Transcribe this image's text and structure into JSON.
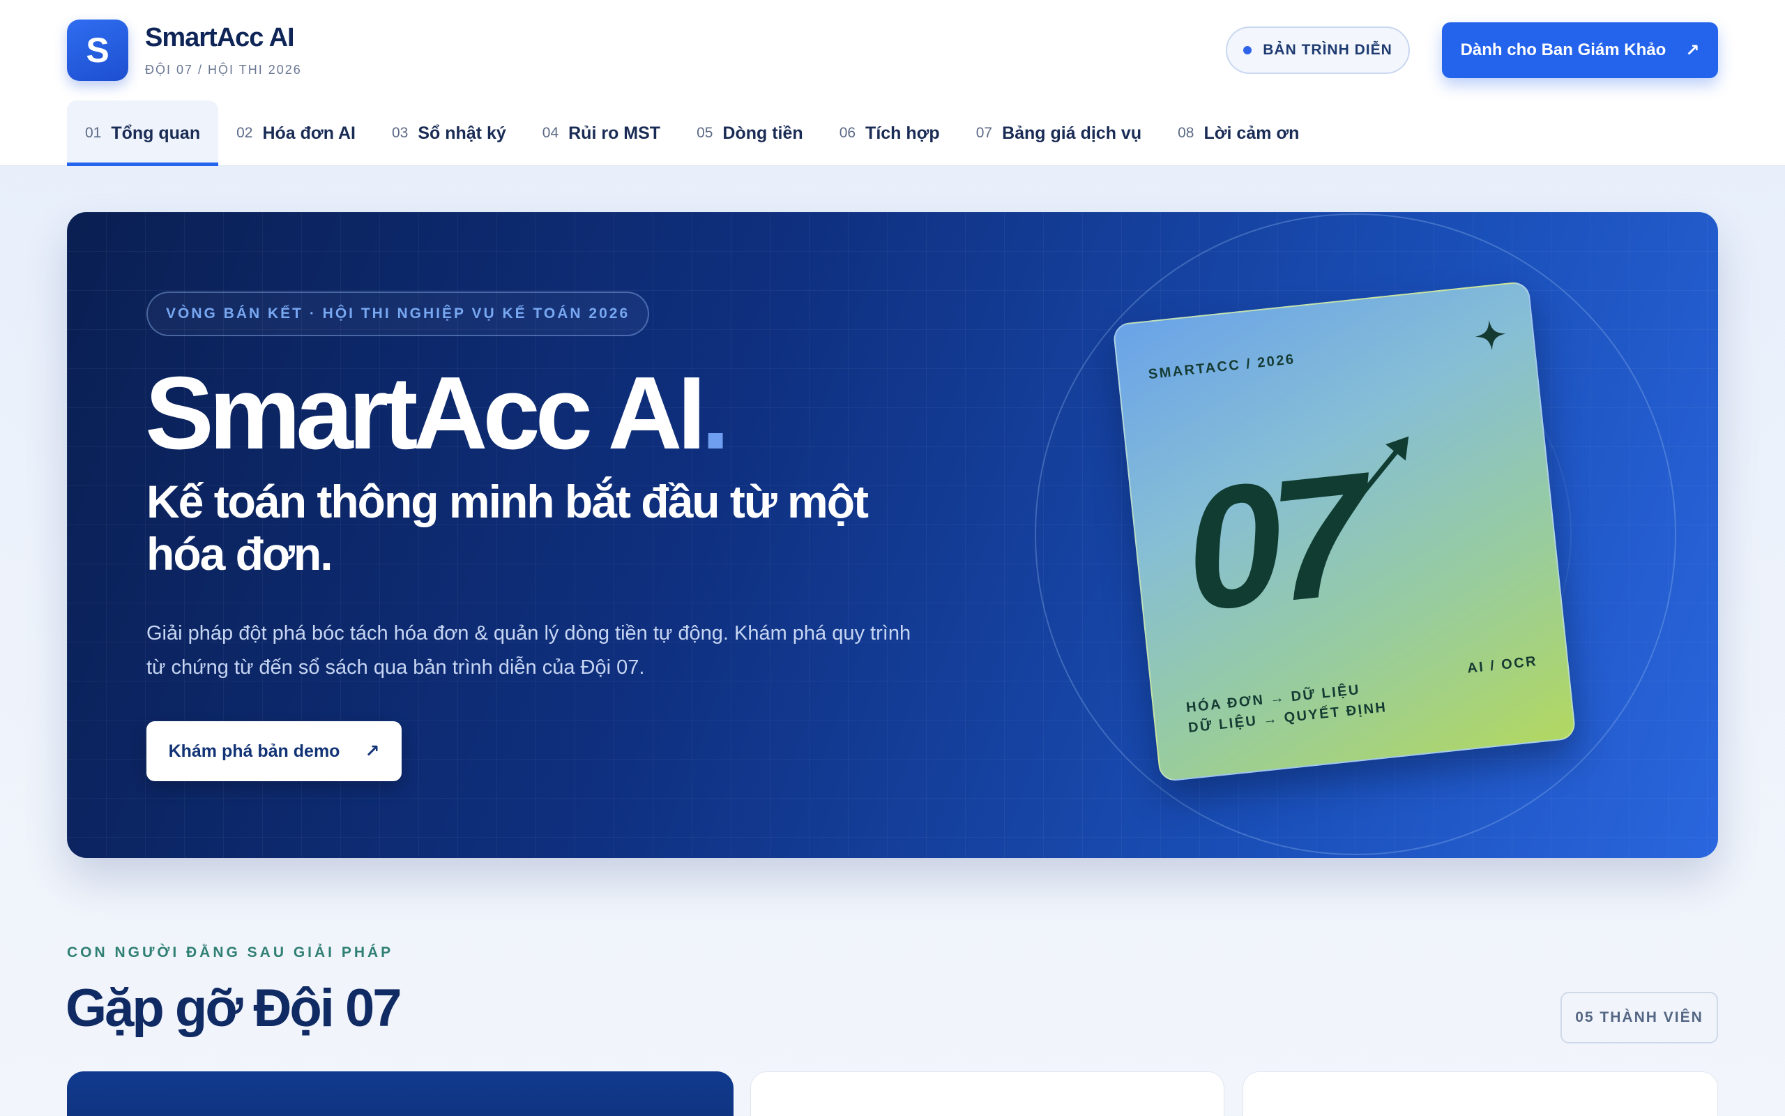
{
  "brand": {
    "logo_letter": "S",
    "name": "SmartAcc AI",
    "subtitle": "ĐỘI 07 / HỘI THI 2026"
  },
  "header": {
    "demo_pill": "BẢN TRÌNH DIỄN",
    "cta_label": "Dành cho Ban Giám Khảo",
    "cta_icon": "arrow-up-right-icon"
  },
  "nav": {
    "items": [
      {
        "num": "01",
        "label": "Tổng quan",
        "active": true
      },
      {
        "num": "02",
        "label": "Hóa đơn AI"
      },
      {
        "num": "03",
        "label": "Sổ nhật ký"
      },
      {
        "num": "04",
        "label": "Rủi ro MST"
      },
      {
        "num": "05",
        "label": "Dòng tiền"
      },
      {
        "num": "06",
        "label": "Tích hợp"
      },
      {
        "num": "07",
        "label": "Bảng giá dịch vụ"
      },
      {
        "num": "08",
        "label": "Lời cảm ơn"
      }
    ]
  },
  "hero": {
    "tag": "VÒNG BÁN KẾT · HỘI THI NGHIỆP VỤ KẾ TOÁN 2026",
    "title": "SmartAcc AI",
    "title_dot": ".",
    "subtitle": "Kế toán thông minh bắt đầu từ một hóa đơn.",
    "description": "Giải pháp đột phá bóc tách hóa đơn & quản lý dòng tiền tự động. Khám phá quy trình từ chứng từ đến sổ sách qua bản trình diễn của Đội 07.",
    "button_label": "Khám phá bản demo",
    "button_icon": "arrow-up-right-icon"
  },
  "card": {
    "label_top": "SMARTACC / 2026",
    "number": "07",
    "line1": "HÓA ĐƠN → DỮ LIỆU",
    "line2": "DỮ LIỆU → QUYẾT ĐỊNH",
    "label_right": "AI / OCR",
    "icons": [
      "sparkle-icon",
      "arrow-up-right-icon"
    ]
  },
  "team": {
    "eyebrow": "CON NGƯỜI ĐẰNG SAU GIẢI PHÁP",
    "title": "Gặp gỡ Đội 07",
    "members_badge": "05 THÀNH VIÊN"
  },
  "colors": {
    "accent": "#2463eb",
    "navy": "#0f2557",
    "hero_start": "#0a1f52",
    "hero_end": "#2a66de",
    "card_green": "#b2d860",
    "teal_eyebrow": "#2f7f73"
  }
}
